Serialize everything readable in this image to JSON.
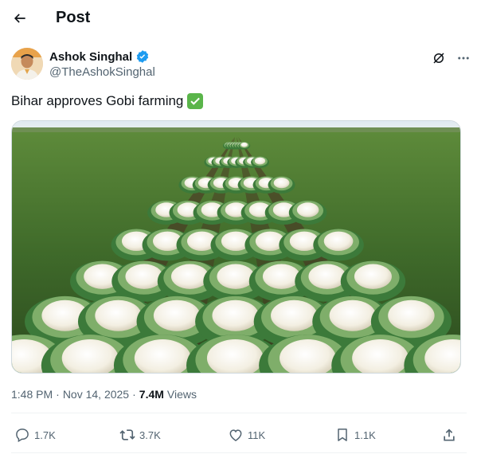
{
  "header": {
    "title": "Post"
  },
  "author": {
    "name": "Ashok Singhal",
    "handle": "@TheAshokSinghal",
    "verified": true
  },
  "tweet": {
    "text": "Bihar approves Gobi farming",
    "emoji": "✅"
  },
  "meta": {
    "time": "1:48 PM",
    "separator": "·",
    "date": "Nov 14, 2025",
    "separator2": "·",
    "views_count": "7.4M",
    "views_label": "Views"
  },
  "actions": {
    "replies": "1.7K",
    "reposts": "3.7K",
    "likes": "11K",
    "bookmarks": "1.1K"
  },
  "colors": {
    "verified_badge": "#1d9bf0",
    "muted_text": "#536471",
    "check_emoji": "#5ab54a"
  }
}
